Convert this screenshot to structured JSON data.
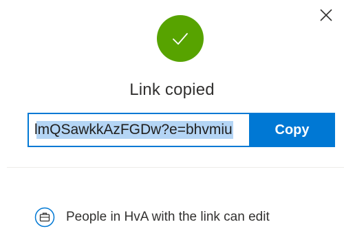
{
  "dialog": {
    "title": "Link copied",
    "link_value": "lmQSawkkAzFGDw?e=bhvmiu",
    "copy_label": "Copy",
    "permission_text": "People in HvA with the link can edit"
  },
  "icons": {
    "close": "close-icon",
    "success": "checkmark-icon",
    "permission": "briefcase-icon"
  },
  "colors": {
    "accent": "#0078d4",
    "success": "#57a300",
    "selection": "#b4d5f5",
    "text": "#323130",
    "divider": "#edebe9"
  }
}
